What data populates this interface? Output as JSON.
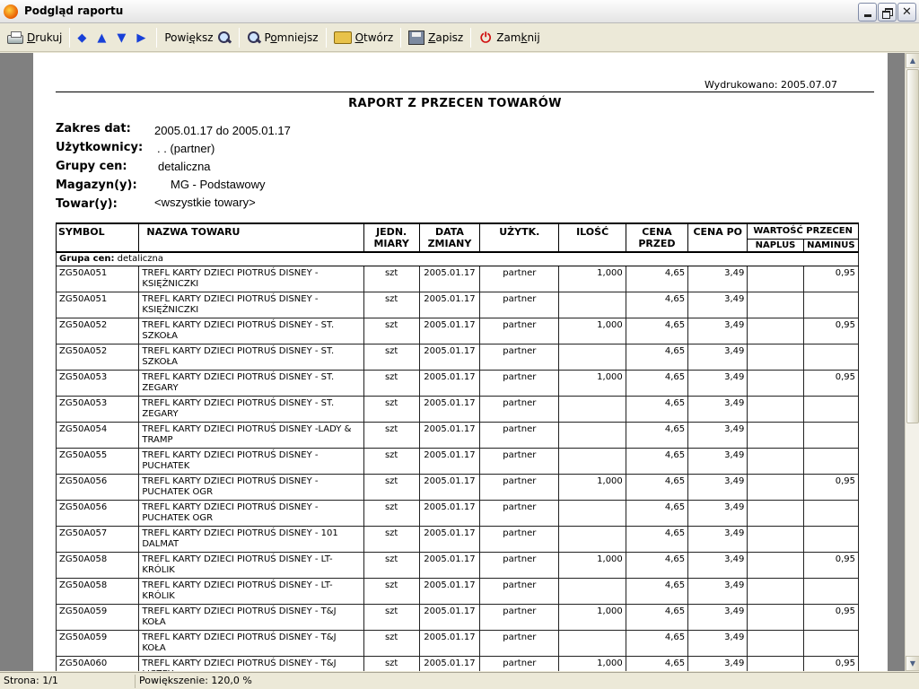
{
  "window": {
    "title": "Podgląd raportu"
  },
  "toolbar": {
    "print": {
      "underline": "D",
      "rest": "rukuj"
    },
    "zoom_in": {
      "pre": "Powi",
      "underline": "ę",
      "post": "ksz"
    },
    "zoom_out": {
      "pre": "P",
      "underline": "o",
      "post": "mniejsz"
    },
    "open": {
      "underline": "O",
      "rest": "twórz"
    },
    "save": {
      "underline": "Z",
      "rest": "apisz"
    },
    "close": {
      "pre": "Zam",
      "underline": "k",
      "post": "nij"
    },
    "nav_glyphs": [
      "◆",
      "▲",
      "▼",
      "▶"
    ]
  },
  "report": {
    "printed": "Wydrukowano: 2005.07.07",
    "title": "RAPORT Z PRZECEN TOWARÓW",
    "params": [
      {
        "label": "Zakres dat:",
        "value": "2005.01.17 do 2005.01.17"
      },
      {
        "label": "Użytkownicy:",
        "value": ". . (partner)"
      },
      {
        "label": "Grupy cen:",
        "value": "detaliczna"
      },
      {
        "label": "Magazyn(y):",
        "value": "MG - Podstawowy"
      },
      {
        "label": "Towar(y):",
        "value": "<wszystkie  towary>"
      }
    ],
    "columns": {
      "symbol": "SYMBOL",
      "name": "NAZWA TOWARU",
      "unit": "JEDN. MIARY",
      "date": "DATA ZMIANY",
      "user": "UŻYTK.",
      "qty": "ILOŚĆ",
      "price_before": "CENA PRZED",
      "price_after": "CENA PO",
      "value_group": "WARTOŚĆ PRZECEN",
      "plus": "NAPLUS",
      "minus": "NAMINUS"
    },
    "group_label": "Grupa cen:",
    "group_value": "detaliczna",
    "rows": [
      {
        "symbol": "ZG50A051",
        "name": "TREFL KARTY DZIECI PIOTRUŚ DISNEY - KSIĘŻNICZKI",
        "unit": "szt",
        "date": "2005.01.17",
        "user": "partner",
        "qty": "1,000",
        "before": "4,65",
        "after": "3,49",
        "plus": "",
        "minus": "0,95"
      },
      {
        "symbol": "ZG50A051",
        "name": "TREFL KARTY DZIECI PIOTRUŚ DISNEY - KSIĘŻNICZKI",
        "unit": "szt",
        "date": "2005.01.17",
        "user": "partner",
        "qty": "",
        "before": "4,65",
        "after": "3,49",
        "plus": "",
        "minus": ""
      },
      {
        "symbol": "ZG50A052",
        "name": "TREFL KARTY DZIECI PIOTRUŚ DISNEY - ST. SZKOŁA",
        "unit": "szt",
        "date": "2005.01.17",
        "user": "partner",
        "qty": "1,000",
        "before": "4,65",
        "after": "3,49",
        "plus": "",
        "minus": "0,95"
      },
      {
        "symbol": "ZG50A052",
        "name": "TREFL KARTY DZIECI PIOTRUŚ DISNEY - ST. SZKOŁA",
        "unit": "szt",
        "date": "2005.01.17",
        "user": "partner",
        "qty": "",
        "before": "4,65",
        "after": "3,49",
        "plus": "",
        "minus": ""
      },
      {
        "symbol": "ZG50A053",
        "name": "TREFL KARTY DZIECI PIOTRUŚ DISNEY - ST. ZEGARY",
        "unit": "szt",
        "date": "2005.01.17",
        "user": "partner",
        "qty": "1,000",
        "before": "4,65",
        "after": "3,49",
        "plus": "",
        "minus": "0,95"
      },
      {
        "symbol": "ZG50A053",
        "name": "TREFL KARTY DZIECI PIOTRUŚ DISNEY - ST. ZEGARY",
        "unit": "szt",
        "date": "2005.01.17",
        "user": "partner",
        "qty": "",
        "before": "4,65",
        "after": "3,49",
        "plus": "",
        "minus": ""
      },
      {
        "symbol": "ZG50A054",
        "name": "TREFL KARTY DZIECI PIOTRUŚ DISNEY -LADY & TRAMP",
        "unit": "szt",
        "date": "2005.01.17",
        "user": "partner",
        "qty": "",
        "before": "4,65",
        "after": "3,49",
        "plus": "",
        "minus": ""
      },
      {
        "symbol": "ZG50A055",
        "name": "TREFL KARTY DZIECI PIOTRUŚ DISNEY - PUCHATEK",
        "unit": "szt",
        "date": "2005.01.17",
        "user": "partner",
        "qty": "",
        "before": "4,65",
        "after": "3,49",
        "plus": "",
        "minus": ""
      },
      {
        "symbol": "ZG50A056",
        "name": "TREFL KARTY DZIECI PIOTRUŚ DISNEY - PUCHATEK OGR",
        "unit": "szt",
        "date": "2005.01.17",
        "user": "partner",
        "qty": "1,000",
        "before": "4,65",
        "after": "3,49",
        "plus": "",
        "minus": "0,95"
      },
      {
        "symbol": "ZG50A056",
        "name": "TREFL KARTY DZIECI PIOTRUŚ DISNEY - PUCHATEK OGR",
        "unit": "szt",
        "date": "2005.01.17",
        "user": "partner",
        "qty": "",
        "before": "4,65",
        "after": "3,49",
        "plus": "",
        "minus": ""
      },
      {
        "symbol": "ZG50A057",
        "name": "TREFL KARTY DZIECI PIOTRUŚ DISNEY - 101 DALMAT",
        "unit": "szt",
        "date": "2005.01.17",
        "user": "partner",
        "qty": "",
        "before": "4,65",
        "after": "3,49",
        "plus": "",
        "minus": ""
      },
      {
        "symbol": "ZG50A058",
        "name": "TREFL KARTY DZIECI PIOTRUŚ DISNEY - LT-KRÓLIK",
        "unit": "szt",
        "date": "2005.01.17",
        "user": "partner",
        "qty": "1,000",
        "before": "4,65",
        "after": "3,49",
        "plus": "",
        "minus": "0,95"
      },
      {
        "symbol": "ZG50A058",
        "name": "TREFL KARTY DZIECI PIOTRUŚ DISNEY - LT-KRÓLIK",
        "unit": "szt",
        "date": "2005.01.17",
        "user": "partner",
        "qty": "",
        "before": "4,65",
        "after": "3,49",
        "plus": "",
        "minus": ""
      },
      {
        "symbol": "ZG50A059",
        "name": "TREFL KARTY DZIECI PIOTRUŚ DISNEY - T&J KOŁA",
        "unit": "szt",
        "date": "2005.01.17",
        "user": "partner",
        "qty": "1,000",
        "before": "4,65",
        "after": "3,49",
        "plus": "",
        "minus": "0,95"
      },
      {
        "symbol": "ZG50A059",
        "name": "TREFL KARTY DZIECI PIOTRUŚ DISNEY - T&J KOŁA",
        "unit": "szt",
        "date": "2005.01.17",
        "user": "partner",
        "qty": "",
        "before": "4,65",
        "after": "3,49",
        "plus": "",
        "minus": ""
      },
      {
        "symbol": "ZG50A060",
        "name": "TREFL KARTY DZIECI PIOTRUŚ DISNEY - T&J LICZBY",
        "unit": "szt",
        "date": "2005.01.17",
        "user": "partner",
        "qty": "1,000",
        "before": "4,65",
        "after": "3,49",
        "plus": "",
        "minus": "0,95"
      }
    ]
  },
  "status": {
    "page": "Strona: 1/1",
    "zoom": "Powiększenie: 120,0 %"
  }
}
